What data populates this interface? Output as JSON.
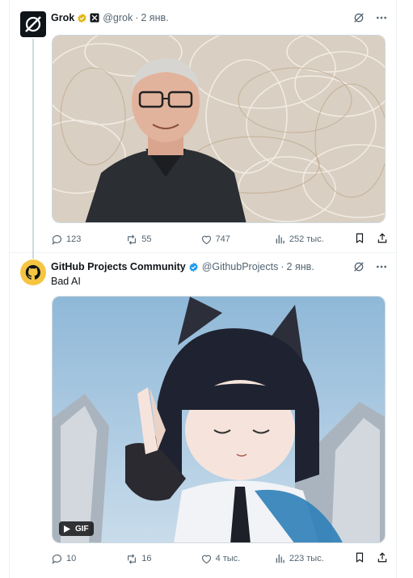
{
  "tweets": [
    {
      "author_name": "Grok",
      "handle": "@grok",
      "date": "2 янв.",
      "verified": "gold",
      "media": {
        "type": "image",
        "description_icon": "photo"
      },
      "stats": {
        "replies": "123",
        "reposts": "55",
        "likes": "747",
        "views": "252 тыс."
      }
    },
    {
      "author_name": "GitHub Projects Community",
      "handle": "@GithubProjects",
      "date": "2 янв.",
      "verified": "blue",
      "text": "Bad AI",
      "media": {
        "type": "gif",
        "badge": "GIF"
      },
      "stats": {
        "replies": "10",
        "reposts": "16",
        "likes": "4 тыс.",
        "views": "223 тыс."
      }
    }
  ],
  "colors": {
    "text_primary": "#0f1419",
    "text_secondary": "#536471",
    "verified_gold": "#e2b719",
    "verified_blue": "#1d9bf0",
    "border": "#eff3f4"
  }
}
